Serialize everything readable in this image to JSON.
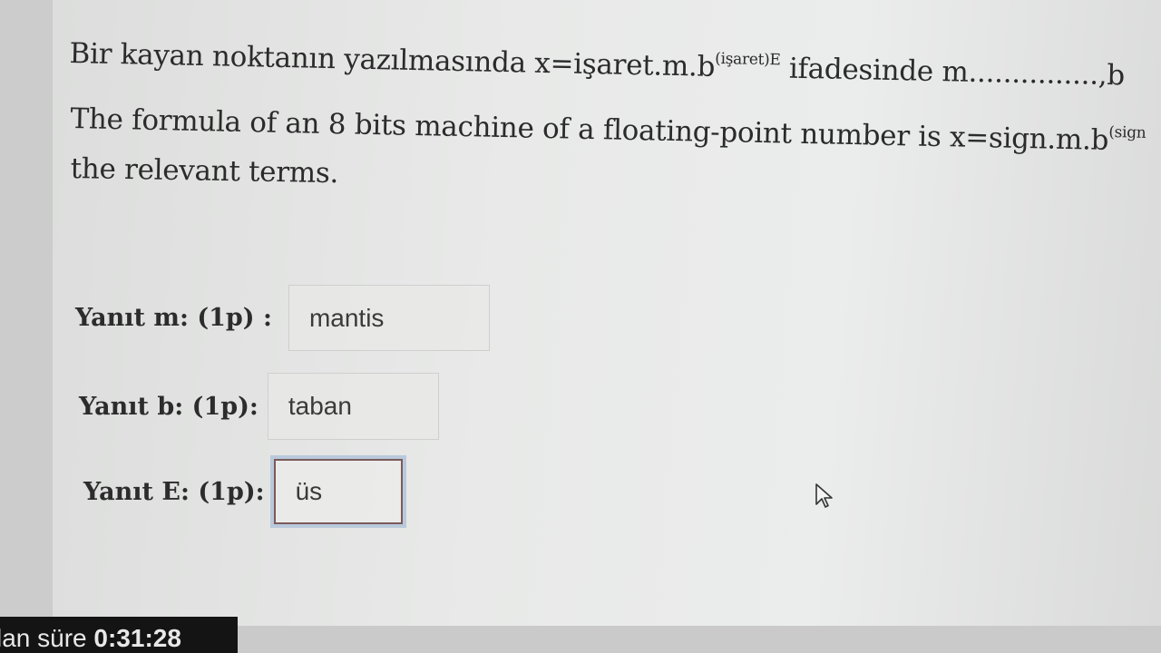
{
  "question": {
    "turkish_prefix": "Bir kayan noktanın yazılmasında x=işaret.m.b",
    "turkish_exponent": "(işaret)E",
    "turkish_suffix": " ifadesinde m...............,b",
    "english_prefix": "The formula of an 8 bits machine of a floating-point number is x=sign.m.b",
    "english_exponent": "(sign",
    "english_line2": "the relevant terms."
  },
  "answers": [
    {
      "label": "Yanıt m: (1p) :",
      "value": "mantis"
    },
    {
      "label": "Yanıt b: (1p):",
      "value": "taban"
    },
    {
      "label": "Yanıt E: (1p):",
      "value": "üs"
    }
  ],
  "timer": {
    "label": "lan süre",
    "value": "0:31:28"
  },
  "icons": {
    "cursor": "mouse-pointer-icon"
  }
}
